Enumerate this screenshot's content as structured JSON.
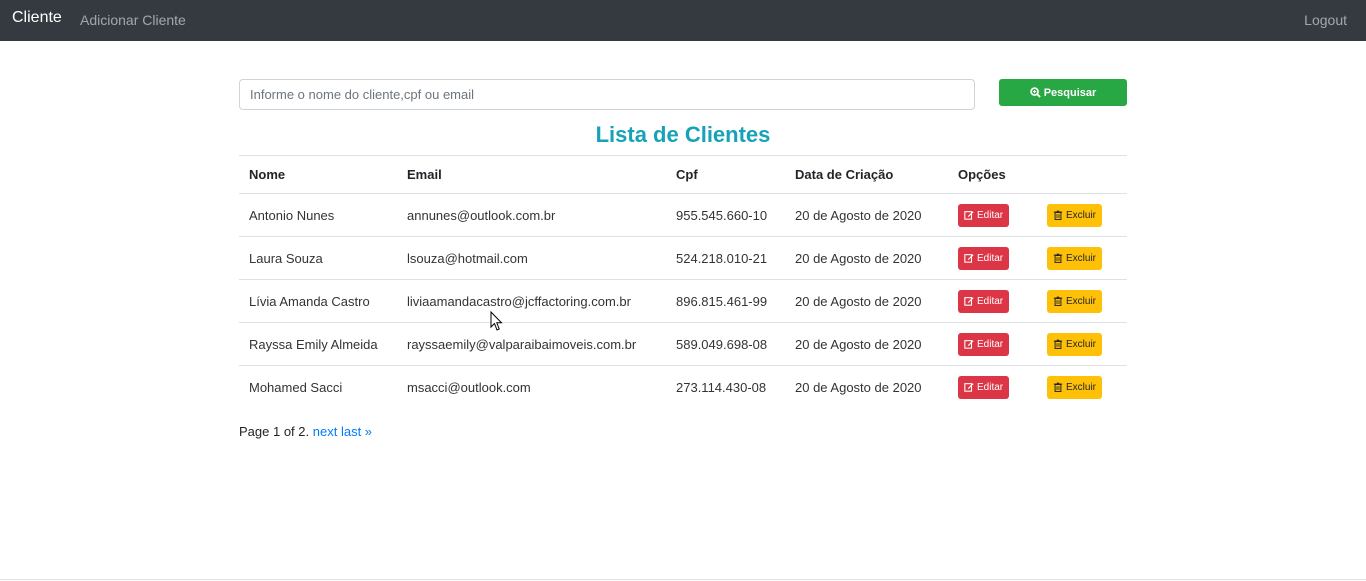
{
  "navbar": {
    "brand": "Cliente",
    "add_link": "Adicionar Cliente",
    "logout": "Logout"
  },
  "search": {
    "placeholder": "Informe o nome do cliente,cpf ou email",
    "value": "",
    "button_label": "Pesquisar"
  },
  "title": "Lista de Clientes",
  "table": {
    "headers": [
      "Nome",
      "Email",
      "Cpf",
      "Data de Criação",
      "Opções"
    ],
    "rows": [
      {
        "nome": "Antonio Nunes",
        "email": "annunes@outlook.com.br",
        "cpf": "955.545.660-10",
        "data": "20 de Agosto de 2020"
      },
      {
        "nome": "Laura Souza",
        "email": "lsouza@hotmail.com",
        "cpf": "524.218.010-21",
        "data": "20 de Agosto de 2020"
      },
      {
        "nome": "Lívia Amanda Castro",
        "email": "liviaamandacastro@jcffactoring.com.br",
        "cpf": "896.815.461-99",
        "data": "20 de Agosto de 2020"
      },
      {
        "nome": "Rayssa Emily Almeida",
        "email": "rayssaemily@valparaibaimoveis.com.br",
        "cpf": "589.049.698-08",
        "data": "20 de Agosto de 2020"
      },
      {
        "nome": "Mohamed Sacci",
        "email": "msacci@outlook.com",
        "cpf": "273.114.430-08",
        "data": "20 de Agosto de 2020"
      }
    ],
    "edit_label": "Editar",
    "delete_label": "Excluir"
  },
  "pagination": {
    "status": "Page 1 of 2.",
    "next": "next",
    "last": "last »"
  },
  "colors": {
    "navbar": "#343a40",
    "search_button": "#28a745",
    "title": "#17a2b8",
    "edit_button": "#dc3545",
    "delete_button": "#ffc107",
    "link": "#007bff"
  },
  "icons": {
    "search_button": "zoom-icon",
    "edit": "edit-icon",
    "delete": "trash-icon",
    "cursor": "mouse-pointer-icon"
  }
}
